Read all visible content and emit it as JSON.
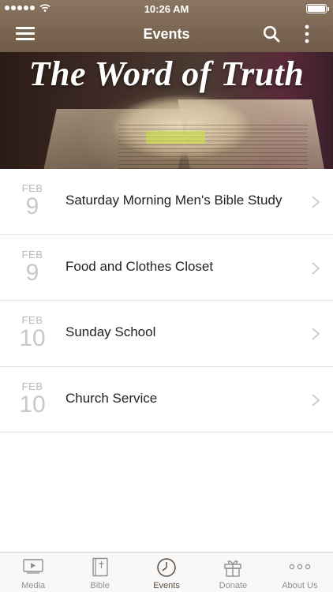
{
  "status_bar": {
    "time": "10:26 AM"
  },
  "nav": {
    "title": "Events"
  },
  "hero": {
    "title": "The Word of Truth"
  },
  "events": [
    {
      "month": "FEB",
      "day": "9",
      "name": "Saturday Morning Men's Bible Study"
    },
    {
      "month": "FEB",
      "day": "9",
      "name": "Food and Clothes Closet"
    },
    {
      "month": "FEB",
      "day": "10",
      "name": "Sunday School"
    },
    {
      "month": "FEB",
      "day": "10",
      "name": "Church Service"
    }
  ],
  "tabs": [
    {
      "label": "Media",
      "icon": "play-icon"
    },
    {
      "label": "Bible",
      "icon": "bible-icon"
    },
    {
      "label": "Events",
      "icon": "clock-icon"
    },
    {
      "label": "Donate",
      "icon": "gift-icon"
    },
    {
      "label": "About Us",
      "icon": "more-dots-icon"
    }
  ],
  "colors": {
    "header": "#7a6652",
    "active_tab": "#5c4a3a",
    "inactive_tab": "#8e8e93"
  }
}
